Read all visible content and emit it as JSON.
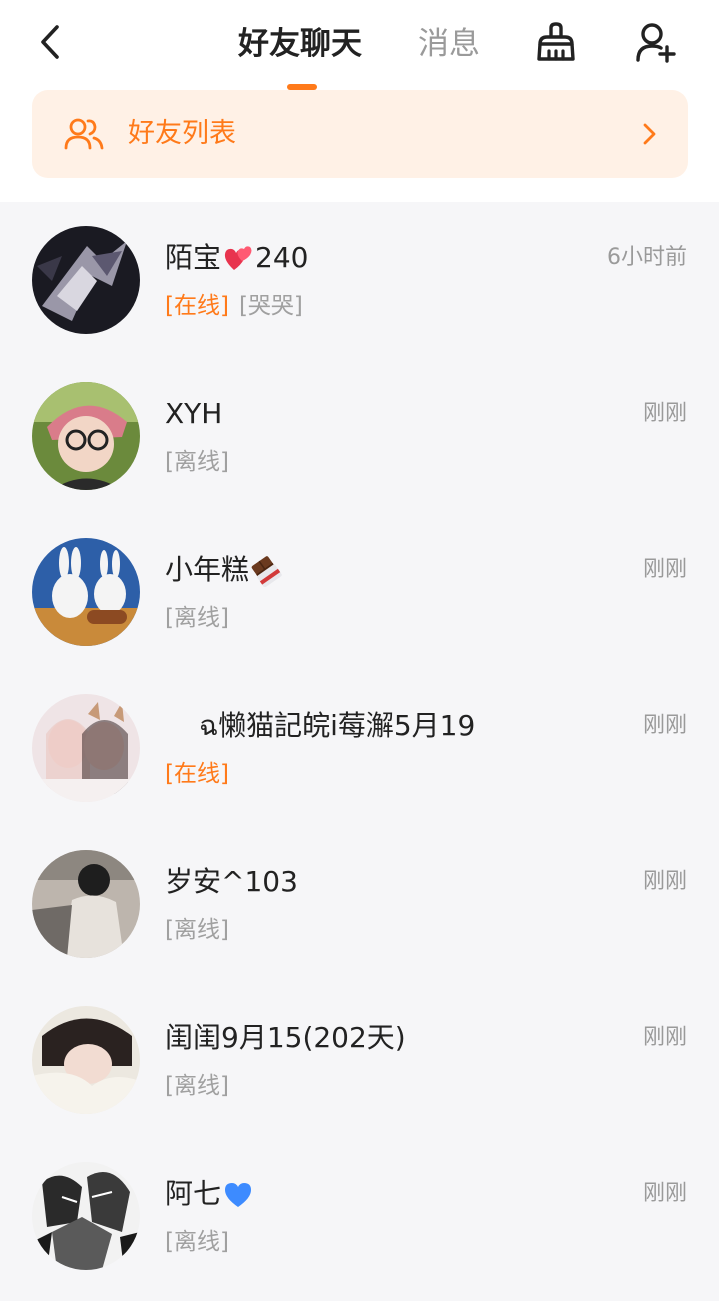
{
  "header": {
    "tabs": [
      {
        "label": "好友聊天",
        "active": true
      },
      {
        "label": "消息",
        "active": false
      }
    ],
    "accent_color": "#ff7a1a"
  },
  "friend_list_banner": {
    "label": "好友列表",
    "icon": "friends-icon"
  },
  "conversations": [
    {
      "name_before": "陌宝",
      "emoji": "heart",
      "name_after": "240",
      "time": "6小时前",
      "status": "[在线]",
      "status_type": "online",
      "extra": "[哭哭]"
    },
    {
      "name_before": "XYH",
      "emoji": "",
      "name_after": "",
      "time": "刚刚",
      "status": "[离线]",
      "status_type": "offline",
      "extra": ""
    },
    {
      "name_before": "小年糕",
      "emoji": "chocolate",
      "name_after": "",
      "time": "刚刚",
      "status": "[离线]",
      "status_type": "offline",
      "extra": ""
    },
    {
      "name_before": "ฉ懒猫記皖i莓澥5月19",
      "emoji": "",
      "name_after": "",
      "time": "刚刚",
      "status": "[在线]",
      "status_type": "online",
      "extra": ""
    },
    {
      "name_before": "岁安^103",
      "emoji": "",
      "name_after": "",
      "time": "刚刚",
      "status": "[离线]",
      "status_type": "offline",
      "extra": ""
    },
    {
      "name_before": "闺闺9月15(202天)",
      "emoji": "",
      "name_after": "",
      "time": "刚刚",
      "status": "[离线]",
      "status_type": "offline",
      "extra": ""
    },
    {
      "name_before": "阿七",
      "emoji": "blue-heart",
      "name_after": "",
      "time": "刚刚",
      "status": "[离线]",
      "status_type": "offline",
      "extra": ""
    }
  ]
}
